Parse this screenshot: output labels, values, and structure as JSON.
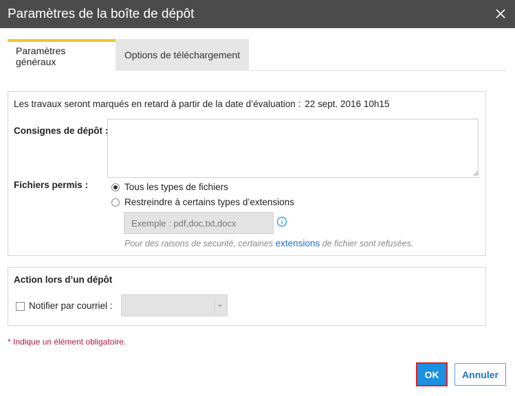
{
  "dialog": {
    "title": "Paramètres de la boîte de dépôt"
  },
  "tabs": [
    {
      "label": "Paramètres généraux",
      "active": true
    },
    {
      "label": "Options de téléchargement",
      "active": false
    }
  ],
  "general": {
    "late_text": "Les travaux seront marqués en retard à partir de la date d’évaluation :",
    "late_date": "22 sept. 2016 10h15",
    "instructions_label": "Consignes de dépôt :",
    "instructions_value": "",
    "files_label": "Fichiers permis :",
    "file_options": [
      {
        "label": "Tous les types de fichiers",
        "checked": true
      },
      {
        "label": "Restreindre à certains types d’extensions",
        "checked": false
      }
    ],
    "extensions_placeholder": "Exemple : pdf,doc,txt,docx",
    "note_before": "Pour des raisons de securité, certaines",
    "note_link": "extensions",
    "note_after": "de fichier sont refusées."
  },
  "action": {
    "title": "Action lors d’un dépôt",
    "notify_label": "Notifier par courriel :",
    "notify_checked": false,
    "notify_select_value": ""
  },
  "footer": {
    "required_note": "* Indique un élément obligatoire.",
    "ok_label": "OK",
    "cancel_label": "Annuler"
  },
  "colors": {
    "titlebar": "#4b4b4b",
    "tab_accent": "#f2c12e",
    "primary": "#1a8fe3",
    "link": "#1a73c8",
    "required": "#b01a3a"
  }
}
